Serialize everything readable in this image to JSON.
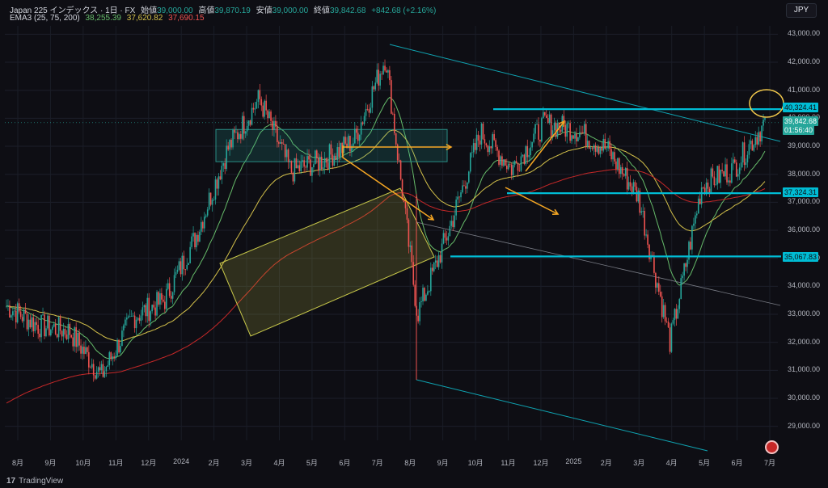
{
  "header": {
    "symbol": "Japan 225 インデックス · 1日 · FX",
    "open_label": "始値",
    "open": "39,000.00",
    "high_label": "高値",
    "high": "39,870.19",
    "low_label": "安値",
    "low": "39,000.00",
    "close_label": "終値",
    "close": "39,842.68",
    "change": "+842.68 (+2.16%)",
    "ema_label": "EMA3 (25, 75, 200)",
    "ema_values": [
      "38,255.39",
      "37,620.82",
      "37,690.15"
    ]
  },
  "currency": "JPY",
  "brand": "TradingView",
  "colors": {
    "bg": "#0e0e14",
    "up": "#26a69a",
    "down": "#ef5350",
    "ema25": "#66bb6a",
    "ema75": "#d4c14a",
    "ema200": "#c62828",
    "cyan": "#00bcd4",
    "orange": "#f5a623",
    "yellow_box": "#c8c84a"
  },
  "y_axis": {
    "labels": [
      "43,000.00",
      "42,000.00",
      "41,000.00",
      "40,000.00",
      "39,000.00",
      "38,000.00",
      "37,000.00",
      "36,000.00",
      "35,000.00",
      "34,000.00",
      "33,000.00",
      "32,000.00",
      "31,000.00",
      "30,000.00",
      "29,000.00"
    ]
  },
  "x_axis": {
    "labels": [
      "8月",
      "9月",
      "10月",
      "11月",
      "12月",
      "2024",
      "2月",
      "3月",
      "4月",
      "5月",
      "6月",
      "7月",
      "8月",
      "9月",
      "10月",
      "11月",
      "12月",
      "2025",
      "2月",
      "3月",
      "4月",
      "5月",
      "6月",
      "7月"
    ]
  },
  "price_tags": {
    "resistance": "40,324.41",
    "current": "39,842.68",
    "countdown": "01:56:40",
    "support1": "37,324.31",
    "support2": "35,067.83"
  },
  "chart_data": {
    "type": "candlestick",
    "symbol": "Japan 225",
    "interval": "1日",
    "ylim": [
      28500,
      43300
    ],
    "x_range": [
      "2023-07",
      "2025-07"
    ],
    "close_path": [
      {
        "month": "2023-07",
        "close": 33300
      },
      {
        "month": "2023-08",
        "close": 32600
      },
      {
        "month": "2023-09",
        "close": 32400
      },
      {
        "month": "2023-10",
        "close": 30800
      },
      {
        "month": "2023-11",
        "close": 32900
      },
      {
        "month": "2023-12",
        "close": 33500
      },
      {
        "month": "2024-01",
        "close": 35800
      },
      {
        "month": "2024-02",
        "close": 38900
      },
      {
        "month": "2024-03",
        "close": 40700
      },
      {
        "month": "2024-04",
        "close": 38100
      },
      {
        "month": "2024-05",
        "close": 38500
      },
      {
        "month": "2024-06",
        "close": 39200
      },
      {
        "month": "2024-07",
        "close": 42200
      },
      {
        "month": "2024-08",
        "close": 33000
      },
      {
        "month": "2024-09",
        "close": 36000
      },
      {
        "month": "2024-10",
        "close": 39500
      },
      {
        "month": "2024-11",
        "close": 38200
      },
      {
        "month": "2024-12",
        "close": 39800
      },
      {
        "month": "2025-01",
        "close": 39600
      },
      {
        "month": "2025-02",
        "close": 38900
      },
      {
        "month": "2025-03",
        "close": 37200
      },
      {
        "month": "2025-04",
        "close": 32000
      },
      {
        "month": "2025-05",
        "close": 37600
      },
      {
        "month": "2025-06",
        "close": 38200
      },
      {
        "month": "2025-07",
        "close": 39842.68
      }
    ],
    "ema": {
      "periods": [
        25,
        75,
        200
      ],
      "last": [
        38255.39,
        37620.82,
        37690.15
      ]
    },
    "levels": [
      40324.41,
      37324.31,
      35067.83
    ],
    "last": {
      "open": 39000.0,
      "high": 39870.19,
      "low": 39000.0,
      "close": 39842.68
    }
  }
}
